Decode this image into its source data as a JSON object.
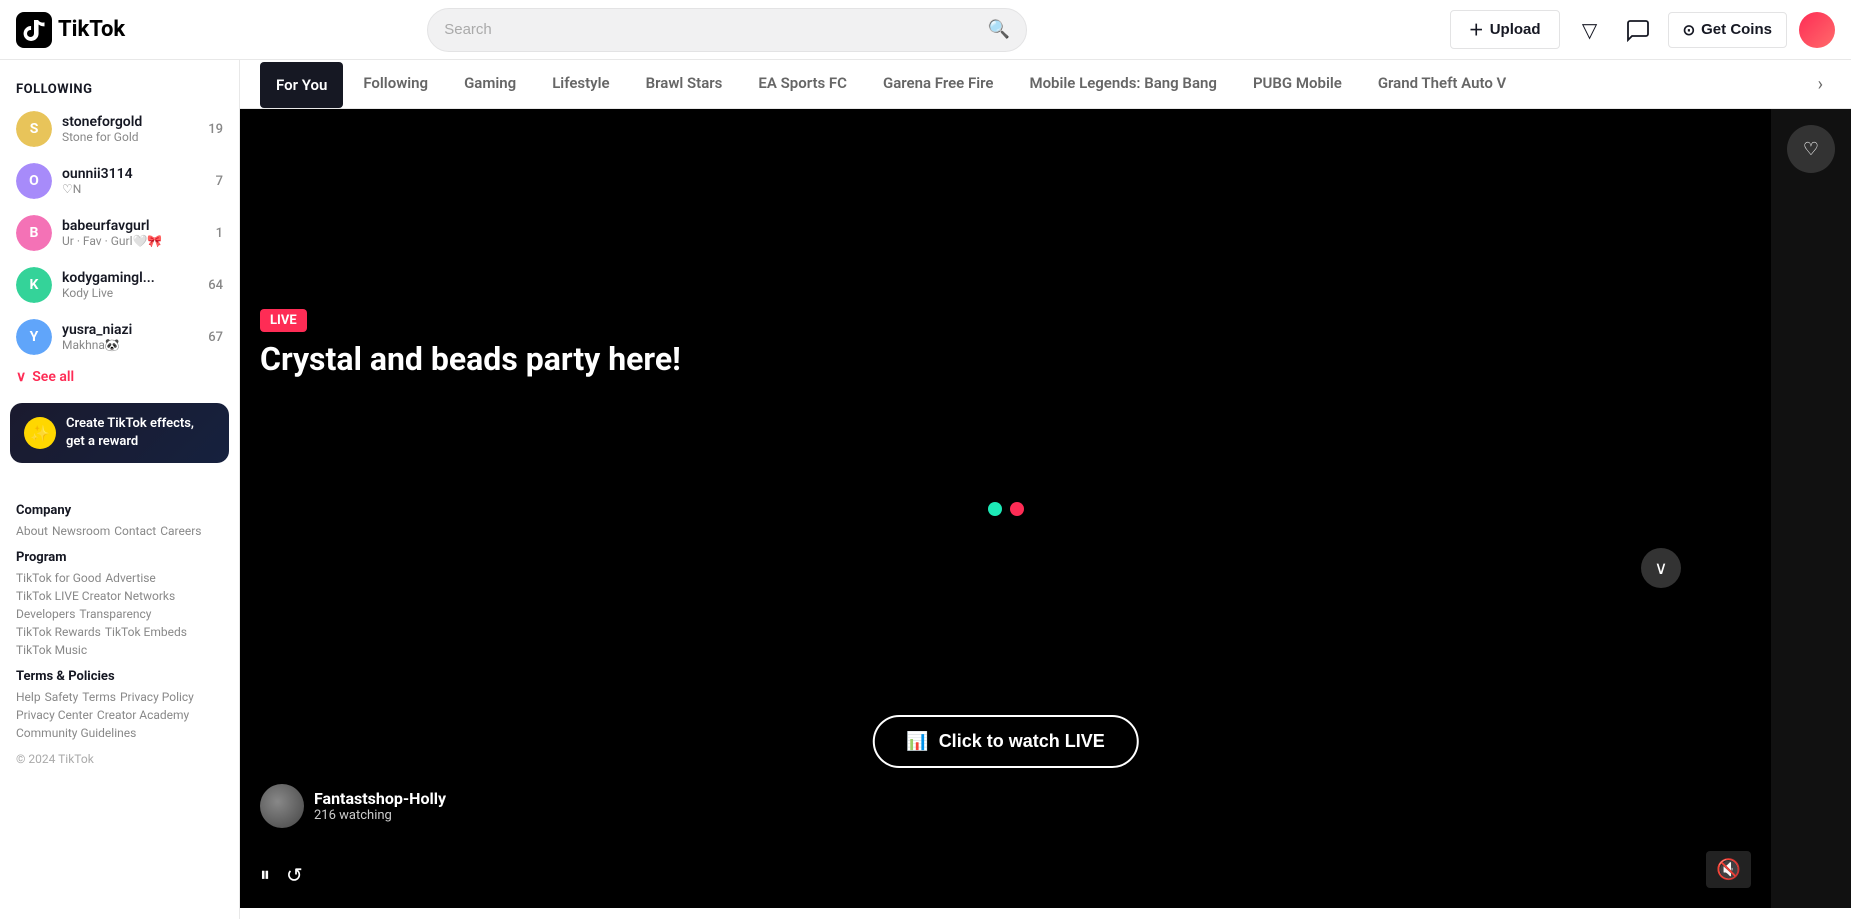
{
  "header": {
    "logo_text": "TikTok",
    "search_placeholder": "Search",
    "upload_label": "Upload",
    "get_coins_label": "Get Coins"
  },
  "sidebar": {
    "following_header": "Following",
    "accounts": [
      {
        "username": "stoneforgold",
        "display": "Stone for Gold",
        "count": 19,
        "color": "#e8c45a"
      },
      {
        "username": "ounnii3114",
        "display": "♡N",
        "count": 7,
        "color": "#a78bfa"
      },
      {
        "username": "babeurfavgurl",
        "display": "Ur · Fav · Gurl🤍🎀",
        "count": 1,
        "color": "#f472b6"
      },
      {
        "username": "kodygamingl...",
        "display": "Kody Live",
        "count": 64,
        "color": "#34d399"
      },
      {
        "username": "yusra_niazi",
        "display": "Makhna🐼",
        "count": 67,
        "color": "#60a5fa"
      }
    ],
    "see_all_label": "See all",
    "effects_banner": {
      "text": "Create TikTok effects, get a reward"
    },
    "footer": {
      "company_label": "Company",
      "company_links": [
        "About",
        "Newsroom",
        "Contact",
        "Careers"
      ],
      "program_label": "Program",
      "program_links": [
        "TikTok for Good",
        "Advertise",
        "TikTok LIVE Creator Networks",
        "Developers",
        "Transparency",
        "TikTok Rewards",
        "TikTok Embeds",
        "TikTok Music"
      ],
      "terms_label": "Terms & Policies",
      "terms_links": [
        "Help",
        "Safety",
        "Terms",
        "Privacy Policy",
        "Privacy Center",
        "Creator Academy",
        "Community Guidelines"
      ],
      "copyright": "© 2024 TikTok"
    }
  },
  "tabs": {
    "items": [
      "For You",
      "Following",
      "Gaming",
      "Lifestyle",
      "Brawl Stars",
      "EA Sports FC",
      "Garena Free Fire",
      "Mobile Legends: Bang Bang",
      "PUBG Mobile",
      "Grand Theft Auto V"
    ],
    "active_index": 0
  },
  "video": {
    "live_label": "LIVE",
    "title": "Crystal and beads party here!",
    "streamer_name": "Fantastshop-Holly",
    "watching_text": "216 watching",
    "watch_live_label": "Click to watch LIVE"
  }
}
